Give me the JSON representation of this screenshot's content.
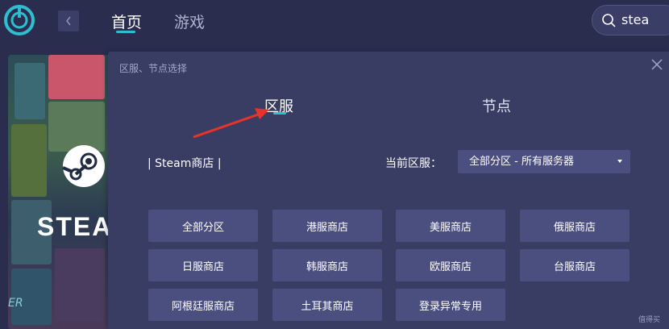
{
  "header": {
    "tabs": [
      {
        "label": "首页",
        "active": true
      },
      {
        "label": "游戏",
        "active": false
      }
    ],
    "search_value": "stea",
    "accent": "#2dbfd0"
  },
  "banner": {
    "logo_text": "STEAM",
    "corner_text": "ER"
  },
  "modal": {
    "title": "区服、节点选择",
    "tabs": [
      {
        "label": "区服",
        "active": true
      },
      {
        "label": "节点",
        "active": false
      }
    ],
    "store_label": "| Steam商店 |",
    "current_region_label": "当前区服：",
    "current_region_value": "全部分区 - 所有服务器",
    "region_buttons": [
      "全部分区",
      "港服商店",
      "美服商店",
      "俄服商店",
      "日服商店",
      "韩服商店",
      "欧服商店",
      "台服商店",
      "阿根廷服商店",
      "土耳其商店",
      "登录异常专用"
    ]
  },
  "watermark": "值得买"
}
